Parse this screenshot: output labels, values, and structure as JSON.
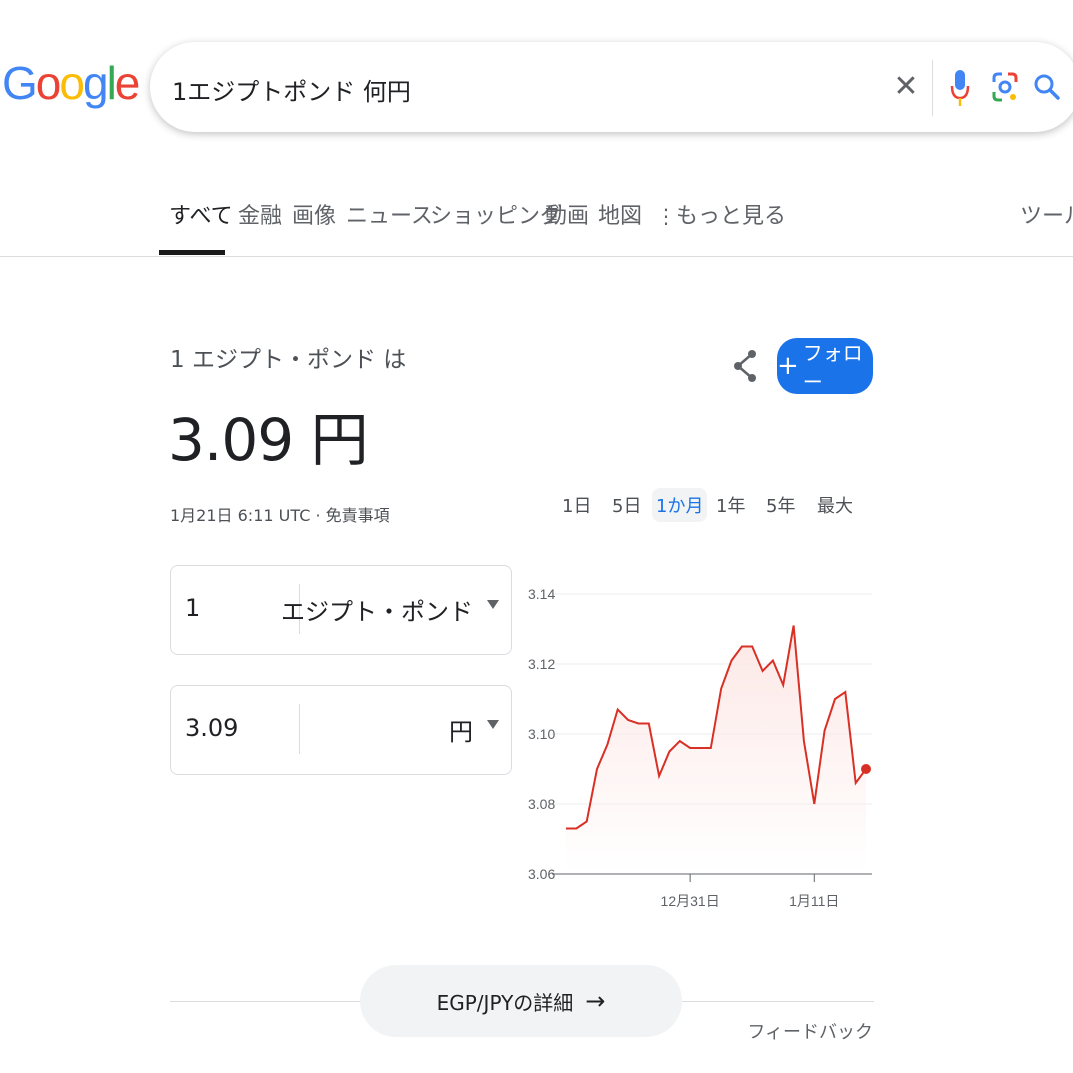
{
  "logo": {
    "letters": [
      "G",
      "o",
      "o",
      "g",
      "l",
      "e"
    ],
    "colors": [
      "#4285F4",
      "#EA4335",
      "#FBBC05",
      "#4285F4",
      "#34A853",
      "#EA4335"
    ]
  },
  "search": {
    "query": "1エジプトポンド 何円"
  },
  "tabs": [
    {
      "label": "すべて",
      "active": true
    },
    {
      "label": "金融"
    },
    {
      "label": "画像"
    },
    {
      "label": "ニュース"
    },
    {
      "label": "ショッピング"
    },
    {
      "label": "動画"
    },
    {
      "label": "地図"
    },
    {
      "label": "もっと見る"
    }
  ],
  "tools_label": "ツール",
  "conversion": {
    "label": "1 エジプト・ポンド は",
    "value": "3.09 円",
    "meta": "1月21日 6:11 UTC · 免責事項",
    "follow_label": "フォロー"
  },
  "ranges": [
    "1日",
    "5日",
    "1か月",
    "1年",
    "5年",
    "最大"
  ],
  "active_range": "1か月",
  "converter": {
    "from_amount": "1",
    "from_currency": "エジプト・ポンド",
    "to_amount": "3.09",
    "to_currency": "円"
  },
  "chart_data": {
    "type": "line",
    "ylim": [
      3.06,
      3.14
    ],
    "yticks": [
      "3.14",
      "3.12",
      "3.10",
      "3.08",
      "3.06"
    ],
    "xticks": [
      {
        "label": "12月31日",
        "index": 12
      },
      {
        "label": "1月11日",
        "index": 24
      }
    ],
    "line_color": "#D93025",
    "values": [
      3.073,
      3.073,
      3.075,
      3.09,
      3.097,
      3.107,
      3.104,
      3.103,
      3.103,
      3.088,
      3.095,
      3.098,
      3.096,
      3.096,
      3.096,
      3.113,
      3.121,
      3.125,
      3.125,
      3.118,
      3.121,
      3.114,
      3.131,
      3.098,
      3.08,
      3.101,
      3.11,
      3.112,
      3.086,
      3.09
    ]
  },
  "more_link": "EGP/JPYの詳細",
  "feedback_label": "フィードバック"
}
